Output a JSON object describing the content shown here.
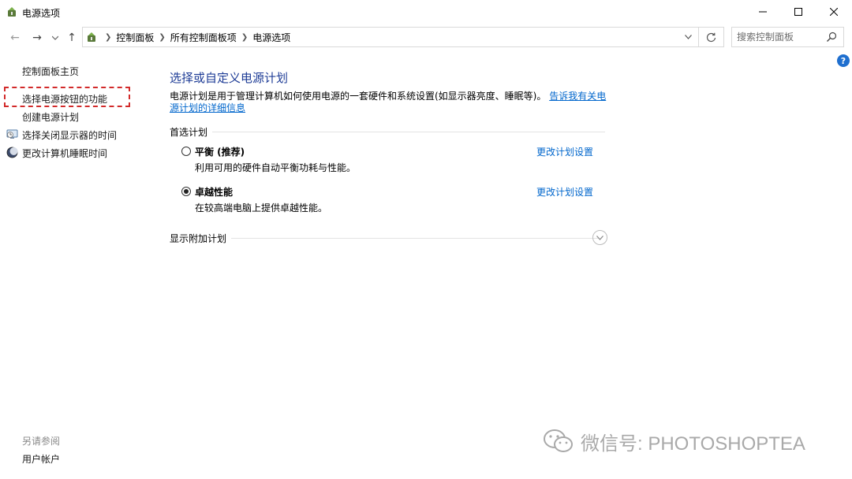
{
  "window": {
    "title": "电源选项",
    "app_icon": "power-options-icon",
    "controls": [
      "minimize-icon",
      "maximize-icon",
      "close-icon"
    ]
  },
  "navigation": {
    "back": "←",
    "forward": "→",
    "recent": "⌄",
    "up": "↑",
    "breadcrumbs": [
      "控制面板",
      "所有控制面板项",
      "电源选项"
    ],
    "search_placeholder": "搜索控制面板",
    "help": "?"
  },
  "sidebar": {
    "home": "控制面板主页",
    "items": [
      {
        "label": "选择电源按钮的功能",
        "highlighted": true
      },
      {
        "label": "创建电源计划"
      },
      {
        "label": "选择关闭显示器的时间",
        "icon": "display-icon"
      },
      {
        "label": "更改计算机睡眠时间",
        "icon": "sleep-icon"
      }
    ],
    "see_also_title": "另请参阅",
    "see_also_items": [
      "用户帐户"
    ],
    "highlight_color": "#d22a2a"
  },
  "main": {
    "title": "选择或自定义电源计划",
    "description": "电源计划是用于管理计算机如何使用电源的一套硬件和系统设置(如显示器亮度、睡眠等)。",
    "description_link": "告诉我有关电源计划的详细信息",
    "preferred_label": "首选计划",
    "plans": [
      {
        "name": "平衡 (推荐)",
        "description": "利用可用的硬件自动平衡功耗与性能。",
        "link": "更改计划设置",
        "selected": false
      },
      {
        "name": "卓越性能",
        "description": "在较高端电脑上提供卓越性能。",
        "link": "更改计划设置",
        "selected": true
      }
    ],
    "additional_label": "显示附加计划",
    "title_color": "#1e3c96",
    "link_color": "#0066cc"
  },
  "watermark": {
    "text": "微信号: PHOTOSHOPTEA"
  }
}
